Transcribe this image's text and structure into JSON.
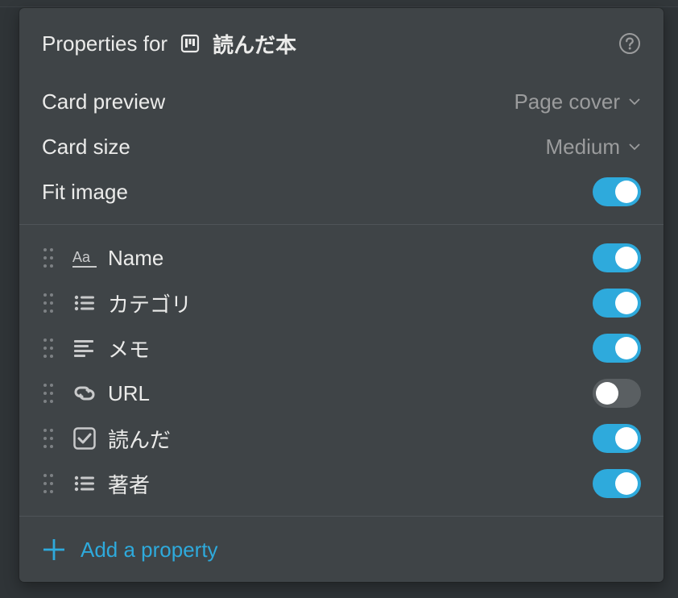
{
  "header": {
    "prefix": "Properties for",
    "database_name": "読んだ本",
    "database_icon": "board-icon",
    "help_icon": "help-icon"
  },
  "settings": {
    "card_preview": {
      "label": "Card preview",
      "value": "Page cover"
    },
    "card_size": {
      "label": "Card size",
      "value": "Medium"
    },
    "fit_image": {
      "label": "Fit image",
      "enabled": true
    }
  },
  "properties": [
    {
      "name": "Name",
      "icon": "text-type-icon",
      "visible": true
    },
    {
      "name": "カテゴリ",
      "icon": "multi-select-icon",
      "visible": true
    },
    {
      "name": "メモ",
      "icon": "rich-text-icon",
      "visible": true
    },
    {
      "name": "URL",
      "icon": "link-icon",
      "visible": false
    },
    {
      "name": "読んだ",
      "icon": "checkbox-icon",
      "visible": true
    },
    {
      "name": "著者",
      "icon": "multi-select-icon",
      "visible": true
    }
  ],
  "footer": {
    "add_label": "Add a property"
  },
  "colors": {
    "panel_bg": "#3f4447",
    "accent": "#2eaadc",
    "text": "#ebebea",
    "muted": "#9b9c9d",
    "toggle_off": "#5a5f62"
  }
}
